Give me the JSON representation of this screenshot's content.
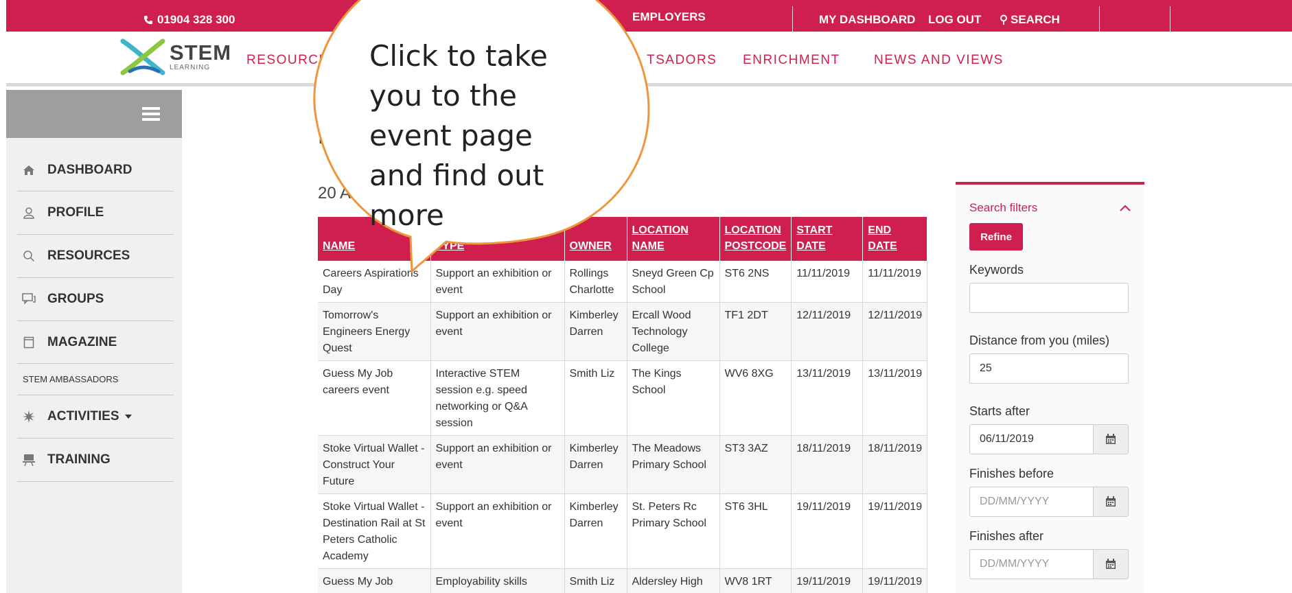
{
  "topbar": {
    "phone": "01904 328 300",
    "employers": "EMPLOYERS",
    "my_dashboard": "MY DASHBOARD",
    "log_out": "LOG OUT",
    "search": "SEARCH"
  },
  "logo": {
    "name": "STEM",
    "sub": "LEARNING"
  },
  "nav": {
    "resources": "RESOURCES",
    "ambassadors": "TSADORS",
    "enrichment": "ENRICHMENT",
    "news": "NEWS AND VIEWS"
  },
  "sidebar": {
    "items": [
      {
        "label": "DASHBOARD",
        "icon": "home-icon"
      },
      {
        "label": "PROFILE",
        "icon": "user-icon"
      },
      {
        "label": "RESOURCES",
        "icon": "search-icon"
      },
      {
        "label": "GROUPS",
        "icon": "chat-icon"
      },
      {
        "label": "MAGAZINE",
        "icon": "magazine-icon"
      },
      {
        "label": "STEM AMBASSADORS",
        "icon": ""
      },
      {
        "label": "ACTIVITIES",
        "icon": "burst-icon"
      },
      {
        "label": "TRAINING",
        "icon": "presentation-icon"
      }
    ]
  },
  "main": {
    "page_head": "I",
    "count_text": "20 Ac"
  },
  "table": {
    "headers": [
      "NAME",
      "TYPE",
      "OWNER",
      "LOCATION NAME",
      "LOCATION POSTCODE",
      "START DATE",
      "END DATE"
    ],
    "rows": [
      [
        "Careers Aspirations Day",
        "Support an exhibition or event",
        "Rollings Charlotte",
        "Sneyd Green Cp School",
        "ST6 2NS",
        "11/11/2019",
        "11/11/2019"
      ],
      [
        "Tomorrow's Engineers Energy Quest",
        "Support an exhibition or event",
        "Kimberley Darren",
        "Ercall Wood Technology College",
        "TF1 2DT",
        "12/11/2019",
        "12/11/2019"
      ],
      [
        "Guess My Job careers event",
        "Interactive STEM session e.g. speed networking or Q&A session",
        "Smith Liz",
        "The Kings School",
        "WV6 8XG",
        "13/11/2019",
        "13/11/2019"
      ],
      [
        "Stoke Virtual Wallet - Construct Your Future",
        "Support an exhibition or event",
        "Kimberley Darren",
        "The Meadows Primary School",
        "ST3 3AZ",
        "18/11/2019",
        "18/11/2019"
      ],
      [
        "Stoke Virtual Wallet - Destination Rail at St Peters Catholic Academy",
        "Support an exhibition or event",
        "Kimberley Darren",
        "St. Peters Rc Primary School",
        "ST6 3HL",
        "19/11/2019",
        "19/11/2019"
      ],
      [
        "Guess My Job careers event",
        "Employability skills session e.g. mock",
        "Smith Liz",
        "Aldersley High School",
        "WV8 1RT",
        "19/11/2019",
        "19/11/2019"
      ]
    ]
  },
  "filters": {
    "title": "Search filters",
    "refine": "Refine",
    "keywords_label": "Keywords",
    "keywords_value": "",
    "distance_label": "Distance from you (miles)",
    "distance_value": "25",
    "starts_after_label": "Starts after",
    "starts_after_value": "06/11/2019",
    "finishes_before_label": "Finishes before",
    "finishes_before_placeholder": "DD/MM/YYYY",
    "finishes_after_label": "Finishes after",
    "finishes_after_placeholder": "DD/MM/YYYY"
  },
  "callout": {
    "text": "Click to take you to the event page and find out more"
  },
  "colors": {
    "brand": "#cf1f4f",
    "callout_border": "#f0963a",
    "sidebar_bg": "#f0f0f0",
    "hamburger_bg": "#9e9e9e"
  }
}
